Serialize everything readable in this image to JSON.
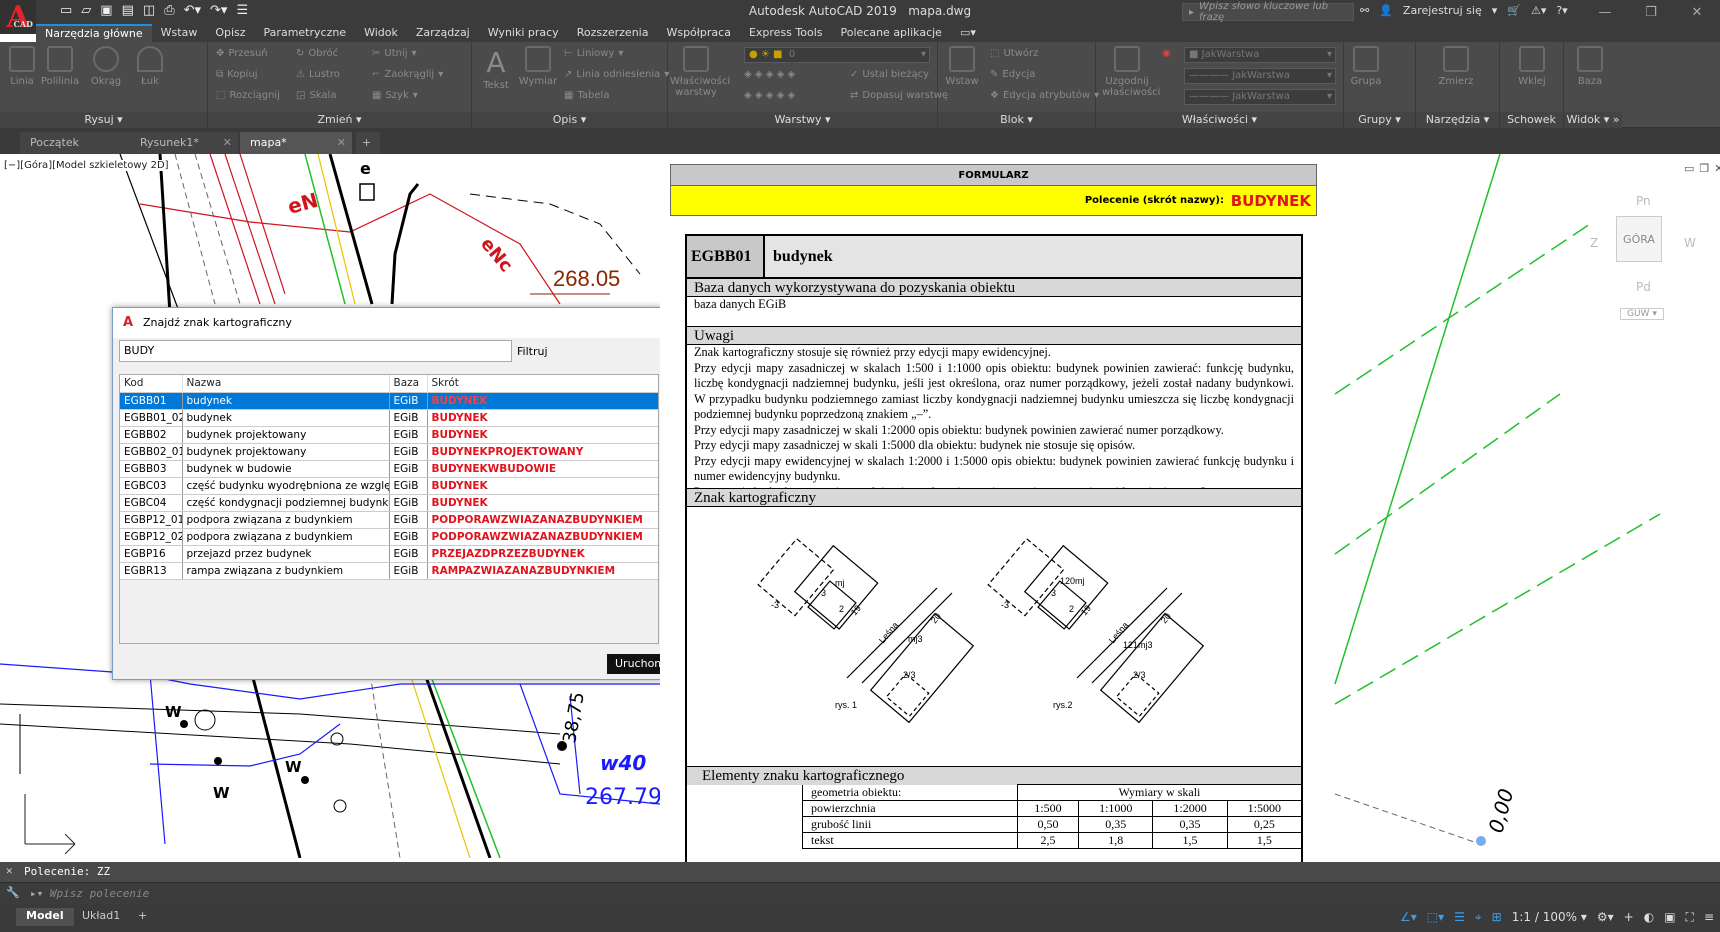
{
  "app": {
    "title": "Autodesk AutoCAD 2019",
    "file": "mapa.dwg",
    "logo": "A",
    "logo_sub": "CAD",
    "search_placeholder": "Wpisz słowo kluczowe lub frazę",
    "signin": "Zarejestruj się"
  },
  "ribbon_tabs": [
    "Narzędzia główne",
    "Wstaw",
    "Opisz",
    "Parametryczne",
    "Widok",
    "Zarządzaj",
    "Wyniki pracy",
    "Rozszerzenia",
    "Współpraca",
    "Express Tools",
    "Polecane aplikacje"
  ],
  "ribbon": {
    "draw": {
      "title": "Rysuj",
      "line": "Linia",
      "polyline": "Polilinia",
      "circle": "Okrąg",
      "arc": "Łuk"
    },
    "modify": {
      "title": "Zmień",
      "move": "Przesuń",
      "rotate": "Obróć",
      "trim": "Utnij",
      "copy": "Kopiuj",
      "mirror": "Lustro",
      "fillet": "Zaokrąglij",
      "stretch": "Rozciągnij",
      "scale": "Skala",
      "array": "Szyk"
    },
    "annotation": {
      "title": "Opis",
      "text": "Tekst",
      "dimension": "Wymiar",
      "linear": "Liniowy",
      "leader": "Linia odniesienia",
      "table": "Tabela"
    },
    "layers": {
      "title": "Warstwy",
      "properties": "Właściwości warstwy",
      "current_layer": "0",
      "make_current": "Ustal bieżący",
      "match": "Dopasuj warstwę"
    },
    "block": {
      "title": "Blok",
      "insert": "Wstaw",
      "create": "Utwórz",
      "edit": "Edycja",
      "edit_attr": "Edycja atrybutów"
    },
    "properties": {
      "title": "Właściwości",
      "match": "Uzgodnij właściwości",
      "color": "JakWarstwa",
      "linetype": "JakWarstwa",
      "lineweight": "JakWarstwa"
    },
    "groups": {
      "title": "Grupy",
      "group": "Grupa"
    },
    "utilities": {
      "title": "Narzędzia",
      "measure": "Zmierz"
    },
    "clipboard": {
      "title": "Schowek",
      "paste": "Wklej"
    },
    "view": {
      "title": "Widok",
      "base": "Baza"
    }
  },
  "doc_tabs": [
    "Początek",
    "Rysunek1*",
    "mapa*"
  ],
  "viewport_label": "[−][Góra][Model szkieletowy 2D]",
  "viewcube": {
    "top": "GÓRA",
    "n": "Pn",
    "s": "Pd",
    "w": "Z",
    "e": "W",
    "ucs": "GUW"
  },
  "map_labels": {
    "eN1": "eN",
    "eN2": "eNc",
    "e": "e",
    "h1": "268.05",
    "h2": "267.79",
    "w40": "w40",
    "w": "W",
    "slope": "0,00",
    "rot": "38,75"
  },
  "dialog": {
    "title": "Znajdź znak kartograficzny",
    "search_value": "BUDY",
    "filter_label": "Filtruj",
    "columns": [
      "Kod",
      "Nazwa",
      "Baza",
      "Skrót"
    ],
    "rows": [
      {
        "kod": "EGBB01",
        "nazwa": "budynek",
        "baza": "EGiB",
        "skrot": "BUDYNEK",
        "selected": true
      },
      {
        "kod": "EGBB01_02",
        "nazwa": "budynek",
        "baza": "EGiB",
        "skrot": "BUDYNEK"
      },
      {
        "kod": "EGBB02",
        "nazwa": "budynek projektowany",
        "baza": "EGiB",
        "skrot": "BUDYNEK"
      },
      {
        "kod": "EGBB02_01",
        "nazwa": "budynek projektowany",
        "baza": "EGiB",
        "skrot": "BUDYNEKPROJEKTOWANY"
      },
      {
        "kod": "EGBB03",
        "nazwa": "budynek w budowie",
        "baza": "EGiB",
        "skrot": "BUDYNEKWBUDOWIE"
      },
      {
        "kod": "EGBC03",
        "nazwa": "część budynku wyodrębniona ze względu na li",
        "baza": "EGiB",
        "skrot": "BUDYNEK"
      },
      {
        "kod": "EGBC04",
        "nazwa": "część kondygnacji podziemnej budynku, która",
        "baza": "EGiB",
        "skrot": "BUDYNEK"
      },
      {
        "kod": "EGBP12_01",
        "nazwa": "podpora związana z budynkiem",
        "baza": "EGiB",
        "skrot": "PODPORAWZWIAZANAZBUDYNKIEM"
      },
      {
        "kod": "EGBP12_02",
        "nazwa": "podpora związana z budynkiem",
        "baza": "EGiB",
        "skrot": "PODPORAWZWIAZANAZBUDYNKIEM"
      },
      {
        "kod": "EGBP16",
        "nazwa": "przejazd przez budynek",
        "baza": "EGiB",
        "skrot": "PRZEJAZDPRZEZBUDYNEK"
      },
      {
        "kod": "EGBR13",
        "nazwa": "rampa związana z budynkiem",
        "baza": "EGiB",
        "skrot": "RAMPAZWIAZANAZBUDYNKIEM"
      }
    ],
    "run_button": "Uruchom"
  },
  "form": {
    "header": "FORMULARZ",
    "command_label": "Polecenie (skrót nazwy):",
    "command_value": "BUDYNEK",
    "code": "EGBB01",
    "name": "budynek",
    "sec_db": "Baza danych wykorzystywana do pozyskania obiektu",
    "db_value": "baza danych EGiB",
    "sec_notes": "Uwagi",
    "notes": "Znak kartograficzny stosuje się również przy edycji mapy ewidencyjnej.\nPrzy edycji mapy zasadniczej w skalach 1:500 i 1:1000 opis obiektu: budynek powinien zawierać: funkcję budynku, liczbę kondygnacji nadziemnej budynku, jeśli jest określona, oraz numer porządkowy, jeżeli został nadany budynkowi. W przypadku budynku podziemnego zamiast liczby kondygnacji nadziemnej budynku umieszcza się liczbę kondygnacji podziemnej budynku poprzedzoną znakiem „–”.\nPrzy edycji mapy zasadniczej w skali 1:2000 opis obiektu: budynek powinien zawierać numer porządkowy.\nPrzy edycji mapy zasadniczej w skali 1:5000 dla obiektu: budynek nie stosuje się opisów.\nPrzy edycji mapy ewidencyjnej w skalach 1:2000 i 1:5000 opis obiektu: budynek powinien zawierać funkcję budynku i numer ewidencyjny budynku.\nPrezentację budynku na mapie zasadniczej przedstawia rys. 1, natomiast na mapie ewidencyjnej – rys. 2.",
    "sec_symbol": "Znak kartograficzny",
    "fig1": {
      "caption": "rys. 1",
      "l1": "-3",
      "l2": "3",
      "l3": "mj",
      "l4": "2",
      "l5": "19",
      "street": "Leśna",
      "num": "20",
      "l6": "mj3",
      "l7": "2/3"
    },
    "fig2": {
      "caption": "rys.2",
      "l1": "-3",
      "l2": "3",
      "l3": "120mj",
      "l4": "2",
      "l5": "19",
      "street": "Leśna",
      "num": "20",
      "l6": "121mj3",
      "l7": "2/3"
    },
    "sec_elements": "Elementy znaku kartograficznego",
    "dims_header": "Wymiary w skali",
    "geom_label": "geometria obiektu:",
    "geom_value": "powierzchnia",
    "scales": [
      "1:500",
      "1:1000",
      "1:2000",
      "1:5000"
    ],
    "line_label": "grubość linii",
    "line_values": [
      "0,50",
      "0,35",
      "0,35",
      "0,25"
    ],
    "text_label": "tekst",
    "text_values": [
      "2,5",
      "1,8",
      "1,5",
      "1,5"
    ]
  },
  "command": {
    "history": "Polecenie: ZZ",
    "placeholder": "Wpisz polecenie"
  },
  "layout_tabs": [
    "Model",
    "Układ1"
  ],
  "status": {
    "scale": "1:1 / 100%"
  }
}
